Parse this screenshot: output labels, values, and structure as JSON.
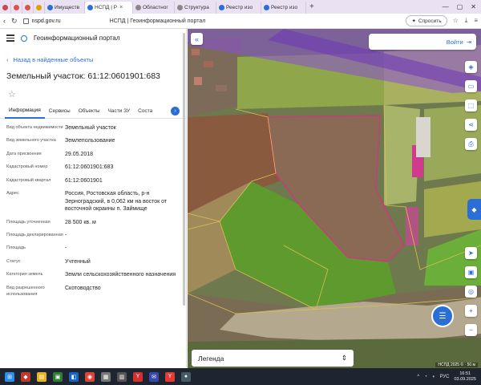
{
  "browser": {
    "tabs": [
      {
        "label": "",
        "color": "#c94a4a"
      },
      {
        "label": "",
        "color": "#e05252"
      },
      {
        "label": "",
        "color": "#d9534f"
      },
      {
        "label": "",
        "color": "#e0a000"
      },
      {
        "label": "Имуществ",
        "color": "#2b6fd6"
      },
      {
        "label": "НСПД | Р",
        "color": "#2b6fd6",
        "active": true
      },
      {
        "label": "Областног",
        "color": "#888888"
      },
      {
        "label": "Структура",
        "color": "#888888"
      },
      {
        "label": "Реестр изо",
        "color": "#2b6fd6"
      },
      {
        "label": "Реестр изо",
        "color": "#2b6fd6"
      }
    ],
    "url": "nspd.gov.ru",
    "page_title": "НСПД | Геоинформационный портал",
    "ask_label": "Спросить"
  },
  "panel": {
    "portal_name": "Геоинформационный портал",
    "back_label": "Назад в найденные объекты",
    "object_title": "Земельный участок: 61:12:0601901:683",
    "tabs": [
      "Информация",
      "Сервисы",
      "Объекты",
      "Части ЗУ",
      "Соста"
    ],
    "attributes": [
      {
        "label": "Вид объекта недвижимости",
        "value": "Земельный участок"
      },
      {
        "label": "Вид земельного участка",
        "value": "Землепользование"
      },
      {
        "label": "Дата присвоения",
        "value": "29.05.2018"
      },
      {
        "label": "Кадастровый номер",
        "value": "61:12:0601901:683"
      },
      {
        "label": "Кадастровый квартал",
        "value": "61:12:0601901"
      },
      {
        "label": "Адрес",
        "value": "Россия, Ростовская область, р-н Зерноградский, в 0,062 км на восток от восточной окраины п. Займище"
      },
      {
        "label": "Площадь уточненная",
        "value": "28 500 кв. м"
      },
      {
        "label": "Площадь декларированная",
        "value": "-"
      },
      {
        "label": "Площадь",
        "value": "-"
      },
      {
        "label": "Статус",
        "value": "Учтенный"
      },
      {
        "label": "Категория земель",
        "value": "Земли сельскохозяйственного назначения"
      },
      {
        "label": "Вид разрешенного использования",
        "value": "Скотоводство"
      }
    ]
  },
  "map": {
    "login_label": "Войти",
    "legend_label": "Легенда",
    "copyright": "НСПД 2025 ©",
    "scale": "50 м"
  },
  "taskbar": {
    "lang": "РУС",
    "time": "16:51",
    "date": "03.09.2025"
  }
}
